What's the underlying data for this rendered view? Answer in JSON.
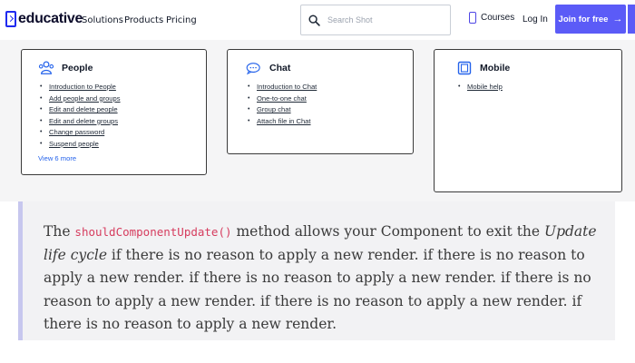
{
  "nav": {
    "logo_text": "educative",
    "links": [
      "Solutions",
      "Products",
      "Pricing"
    ],
    "search_placeholder": "Search Shot",
    "courses_label": "Courses",
    "login_label": "Log In",
    "join_label": "Join for free",
    "accent_color": "#5b5bf7"
  },
  "cards": [
    {
      "title": "People",
      "icon": "people-icon",
      "items": [
        "Introduction to People",
        "Add people and groups",
        "Edit and delete people",
        "Edit and delete groups",
        "Change password",
        "Suspend people"
      ],
      "view_more": "View 6 more"
    },
    {
      "title": "Chat",
      "icon": "chat-icon",
      "items": [
        "Introduction to Chat",
        "One-to-one chat",
        "Group chat",
        "Attach file in Chat"
      ]
    },
    {
      "title": "Mobile",
      "icon": "mobile-icon",
      "items": [
        "Mobile help"
      ]
    }
  ],
  "article": {
    "p1": "The ",
    "code": "shouldComponentUpdate()",
    "p2": " method allows your Component to exit the ",
    "em": "Update life cycle",
    "p3": " if there is no reason to apply a new render. if there is no reason to apply a new render. if there is no reason to apply a new render. if there is no reason to apply a new render. if there is no reason to apply a new render. if there is no reason to apply a new render."
  }
}
